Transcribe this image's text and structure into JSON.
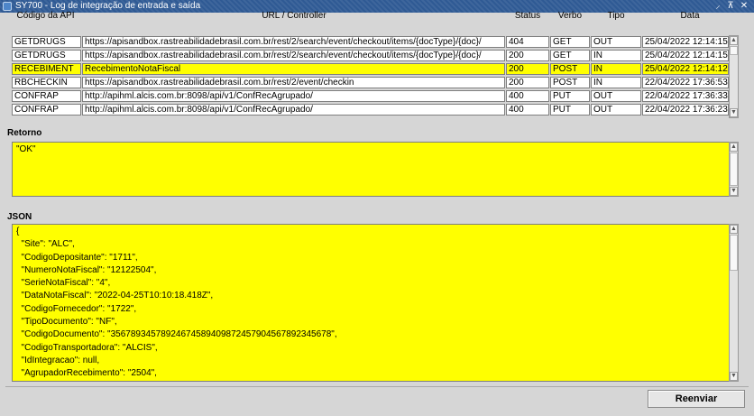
{
  "window": {
    "title": "SY700 - Log de integração de entrada e saída",
    "controls": [
      "⸝",
      "⊼",
      "✕"
    ]
  },
  "grid": {
    "headers": {
      "codigo": "Código da API",
      "url": "URL / Controller",
      "status": "Status",
      "verbo": "Verbo",
      "tipo": "Tipo",
      "data": "Data"
    },
    "rows": [
      {
        "codigo": "GETDRUGS",
        "url": "https://apisandbox.rastreabilidadebrasil.com.br/rest/2/search/event/checkout/items/{docType}/{doc}/",
        "status": "404",
        "verbo": "GET",
        "tipo": "OUT",
        "data": "25/04/2022 12:14:15",
        "selected": false
      },
      {
        "codigo": "GETDRUGS",
        "url": "https://apisandbox.rastreabilidadebrasil.com.br/rest/2/search/event/checkout/items/{docType}/{doc}/",
        "status": "200",
        "verbo": "GET",
        "tipo": "IN",
        "data": "25/04/2022 12:14:15",
        "selected": false
      },
      {
        "codigo": "RECEBIMENT",
        "url": "RecebimentoNotaFiscal",
        "status": "200",
        "verbo": "POST",
        "tipo": "IN",
        "data": "25/04/2022 12:14:12",
        "selected": true
      },
      {
        "codigo": "RBCHECKIN",
        "url": "https://apisandbox.rastreabilidadebrasil.com.br/rest/2/event/checkin",
        "status": "200",
        "verbo": "POST",
        "tipo": "IN",
        "data": "22/04/2022 17:36:53",
        "selected": false
      },
      {
        "codigo": "CONFRAP",
        "url": "http://apihml.alcis.com.br:8098/api/v1/ConfRecAgrupado/",
        "status": "400",
        "verbo": "PUT",
        "tipo": "OUT",
        "data": "22/04/2022 17:36:33",
        "selected": false
      },
      {
        "codigo": "CONFRAP",
        "url": "http://apihml.alcis.com.br:8098/api/v1/ConfRecAgrupado/",
        "status": "400",
        "verbo": "PUT",
        "tipo": "OUT",
        "data": "22/04/2022 17:36:23",
        "selected": false
      }
    ]
  },
  "retorno": {
    "label": "Retorno",
    "value": "\"OK\""
  },
  "json": {
    "label": "JSON",
    "value": "{\n  \"Site\": \"ALC\",\n  \"CodigoDepositante\": \"1711\",\n  \"NumeroNotaFiscal\": \"12122504\",\n  \"SerieNotaFiscal\": \"4\",\n  \"DataNotaFiscal\": \"2022-04-25T10:10:18.418Z\",\n  \"CodigoFornecedor\": \"1722\",\n  \"TipoDocumento\": \"NF\",\n  \"CodigoDocumento\": \"35678934578924674589409872457904567892345678\",\n  \"CodigoTransportadora\": \"ALCIS\",\n  \"IdIntegracao\": null,\n  \"AgrupadorRecebimento\": \"2504\","
  },
  "actions": {
    "reenviar": "Reenviar"
  }
}
